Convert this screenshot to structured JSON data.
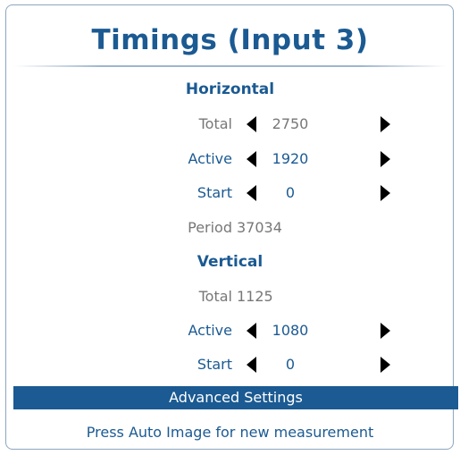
{
  "title": "Timings (Input 3)",
  "horizontal": {
    "heading": "Horizontal",
    "total": {
      "label": "Total",
      "value": "2750"
    },
    "active": {
      "label": "Active",
      "value": "1920"
    },
    "start": {
      "label": "Start",
      "value": "0"
    },
    "period": {
      "label": "Period",
      "value": "37034"
    }
  },
  "vertical": {
    "heading": "Vertical",
    "total": {
      "label": "Total",
      "value": "1125"
    },
    "active": {
      "label": "Active",
      "value": "1080"
    },
    "start": {
      "label": "Start",
      "value": "0"
    }
  },
  "advanced_label": "Advanced Settings",
  "footer_text": "Press Auto Image for new measurement",
  "colors": {
    "accent": "#1b5a92",
    "muted": "#777777",
    "arrow": "#000000"
  },
  "icons": {
    "decrease": "left-triangle-icon",
    "increase": "right-triangle-icon"
  }
}
